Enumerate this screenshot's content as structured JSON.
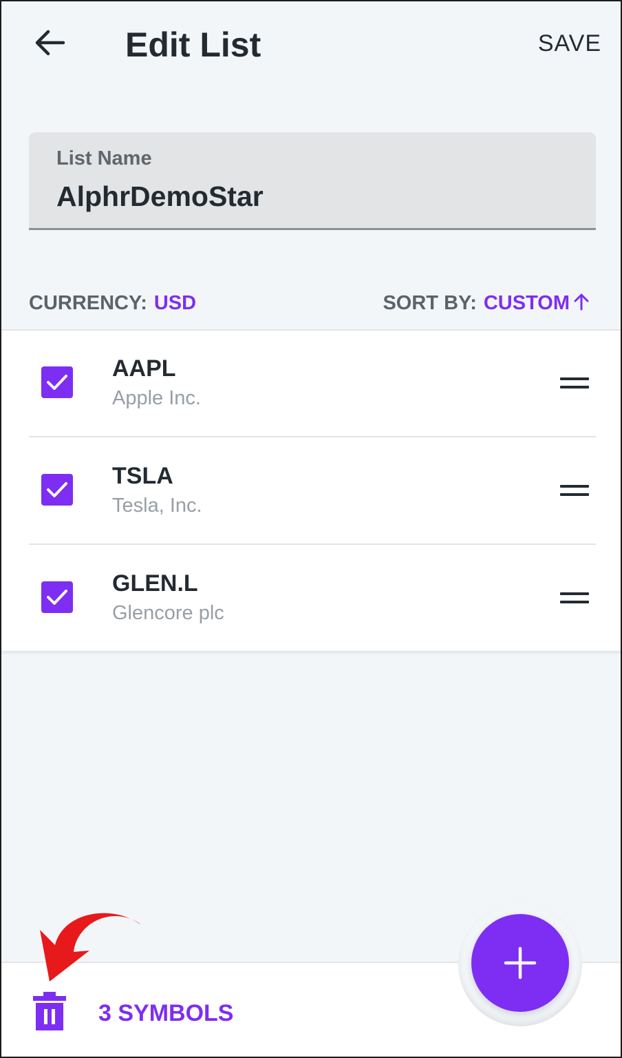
{
  "header": {
    "back_icon": "arrow-left-icon",
    "title": "Edit List",
    "save_label": "SAVE"
  },
  "list_name": {
    "label": "List Name",
    "value": "AlphrDemoStar"
  },
  "options": {
    "currency_label": "CURRENCY:",
    "currency_value": "USD",
    "sort_label": "SORT BY:",
    "sort_value": "CUSTOM",
    "sort_icon": "arrow-up-icon"
  },
  "items": [
    {
      "symbol": "AAPL",
      "company": "Apple Inc.",
      "checked": true
    },
    {
      "symbol": "TSLA",
      "company": "Tesla, Inc.",
      "checked": true
    },
    {
      "symbol": "GLEN.L",
      "company": "Glencore plc",
      "checked": true
    }
  ],
  "bottom": {
    "trash_icon": "trash-icon",
    "symbols_count": "3 SYMBOLS",
    "add_icon": "plus-icon"
  },
  "annotation": {
    "icon": "curved-arrow-icon",
    "color": "#e8191b"
  },
  "colors": {
    "accent": "#7d2ef2",
    "text": "#232a31",
    "subtext": "#979ea5",
    "background": "#f3f6f9"
  }
}
